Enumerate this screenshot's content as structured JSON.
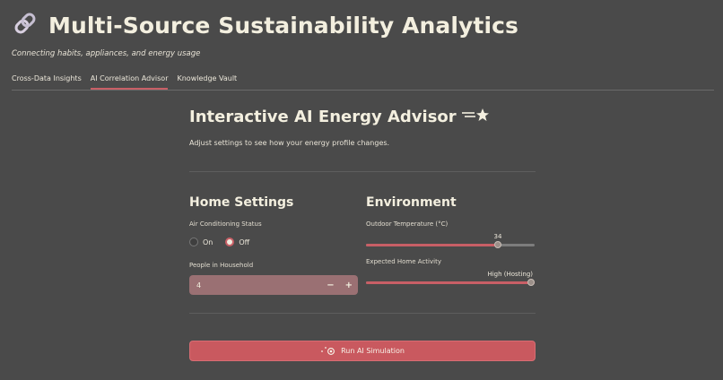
{
  "app": {
    "title": "Multi-Source Sustainability Analytics",
    "subtitle": "Connecting habits, appliances, and energy usage"
  },
  "tabs": [
    {
      "label": "Cross-Data Insights",
      "active": false
    },
    {
      "label": "AI Correlation Advisor",
      "active": true
    },
    {
      "label": "Knowledge Vault",
      "active": false
    }
  ],
  "main": {
    "title": "Interactive AI Energy Advisor",
    "description": "Adjust settings to see how your energy profile changes."
  },
  "home_settings": {
    "title": "Home Settings",
    "ac_label": "Air Conditioning Status",
    "ac_options": [
      "On",
      "Off"
    ],
    "ac_selected": "Off",
    "people_label": "People in Household",
    "people_value": "4",
    "minus": "−",
    "plus": "+"
  },
  "environment": {
    "title": "Environment",
    "temp_label": "Outdoor Temperature (°C)",
    "temp_value": "34",
    "temp_fraction": 0.78,
    "activity_label": "Expected Home Activity",
    "activity_value": "High (Hosting)",
    "activity_fraction": 1.0
  },
  "run_button": {
    "label": "Run AI Simulation"
  },
  "colors": {
    "accent": "#c85f66",
    "background": "#4a4a4a"
  }
}
